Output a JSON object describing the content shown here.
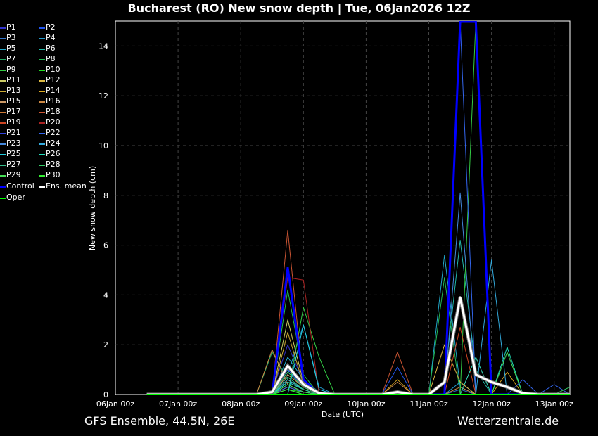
{
  "title": "Bucharest  (RO)  New snow depth | Tue, 06Jan2026 12Z",
  "footer": {
    "left": "GFS Ensemble, 44.5N, 26E",
    "right": "Wetterzentrale.de"
  },
  "colors": {
    "background": "#000000",
    "grid": "#444444",
    "control": "#0000ff",
    "ens_mean": "#ffffff",
    "oper": "#00ff00"
  },
  "chart_data": {
    "type": "line",
    "title": "Bucharest  (RO)  New snow depth | Tue, 06Jan2026 12Z",
    "xlabel": "Date (UTC)",
    "ylabel": "New snow depth (cm)",
    "x_ticks": [
      "06Jan 00z",
      "07Jan 00z",
      "08Jan 00z",
      "09Jan 00z",
      "10Jan 00z",
      "11Jan 00z",
      "12Jan 00z",
      "13Jan 00z"
    ],
    "y_ticks": [
      0,
      2,
      4,
      6,
      8,
      10,
      12,
      14
    ],
    "ylim": [
      0,
      15
    ],
    "xlim_hours": [
      0,
      174
    ],
    "grid": true,
    "legend_placement": "left",
    "x_hours": [
      12,
      18,
      24,
      30,
      36,
      42,
      48,
      54,
      60,
      66,
      72,
      78,
      84,
      90,
      96,
      102,
      108,
      114,
      120,
      126,
      132,
      138,
      144,
      150,
      156,
      162,
      168,
      174
    ],
    "series": [
      {
        "name": "P1",
        "color": "#3333cc",
        "values": [
          0,
          0,
          0,
          0,
          0,
          0,
          0,
          0,
          0.1,
          2.0,
          0.5,
          0.1,
          0,
          0,
          0,
          0,
          0,
          0,
          0,
          0,
          0,
          0,
          0,
          0,
          0,
          0,
          0,
          0
        ]
      },
      {
        "name": "P2",
        "color": "#2255ee",
        "values": [
          0,
          0,
          0,
          0,
          0,
          0,
          0,
          0,
          0,
          1.0,
          0.3,
          0,
          0,
          0,
          0,
          0,
          1.1,
          0,
          0,
          0,
          0,
          0,
          0,
          0,
          0,
          0,
          0,
          0
        ]
      },
      {
        "name": "P3",
        "color": "#3377cc",
        "values": [
          0,
          0,
          0,
          0,
          0,
          0,
          0,
          0,
          0,
          0.5,
          0.2,
          0,
          0,
          0,
          0,
          0,
          0,
          0,
          0,
          0,
          0.2,
          0,
          0,
          0,
          0,
          0,
          0,
          0
        ]
      },
      {
        "name": "P4",
        "color": "#2299cc",
        "values": [
          0,
          0,
          0,
          0,
          0,
          0,
          0,
          0,
          0,
          0.8,
          2.8,
          0.3,
          0,
          0,
          0,
          0,
          0,
          0,
          0,
          0,
          0.5,
          0,
          0,
          0,
          0,
          0,
          0,
          0
        ]
      },
      {
        "name": "P5",
        "color": "#22aacc",
        "values": [
          0,
          0,
          0,
          0,
          0,
          0,
          0,
          0,
          0,
          1.5,
          0.6,
          0.1,
          0,
          0,
          0,
          0,
          0,
          0,
          0,
          5.6,
          0.3,
          0,
          0,
          0,
          0,
          0,
          0,
          0
        ]
      },
      {
        "name": "P6",
        "color": "#22bbaa",
        "values": [
          0,
          0,
          0,
          0,
          0,
          0,
          0,
          0,
          0,
          0.3,
          0.1,
          0,
          0,
          0,
          0,
          0,
          0,
          0,
          0,
          0.5,
          6.2,
          1.0,
          0,
          0,
          0,
          0,
          0,
          0
        ]
      },
      {
        "name": "P7",
        "color": "#22aa66",
        "values": [
          0,
          0,
          0,
          0,
          0,
          0,
          0,
          0,
          1.7,
          0.6,
          0.2,
          0,
          0,
          0,
          0,
          0,
          0,
          0,
          0,
          0,
          0,
          0,
          0,
          0,
          0,
          0,
          0,
          0
        ]
      },
      {
        "name": "P8",
        "color": "#22bb55",
        "values": [
          0,
          0,
          0,
          0,
          0,
          0,
          0,
          0,
          0,
          4.2,
          0.8,
          0,
          0,
          0,
          0,
          0,
          0,
          0,
          0,
          4.7,
          0,
          0,
          0,
          0,
          0,
          0,
          0,
          0
        ]
      },
      {
        "name": "P9",
        "color": "#33cc44",
        "values": [
          0,
          0,
          0,
          0,
          0,
          0,
          0,
          0,
          0,
          0,
          3.5,
          1.5,
          0,
          0,
          0,
          0,
          0,
          0,
          0,
          0,
          0,
          15,
          0,
          0,
          0,
          0,
          0,
          0
        ]
      },
      {
        "name": "P10",
        "color": "#22dd22",
        "values": [
          0,
          0,
          0,
          0,
          0,
          0,
          0,
          0,
          0,
          0.2,
          0.1,
          0,
          0,
          0,
          0,
          0,
          0,
          0,
          0,
          0,
          0,
          0,
          0,
          0,
          0,
          0,
          0,
          0
        ]
      },
      {
        "name": "P11",
        "color": "#cccc66",
        "values": [
          0,
          0,
          0,
          0,
          0,
          0,
          0,
          0,
          0,
          3.0,
          0.5,
          0,
          0,
          0,
          0,
          0,
          0,
          0,
          0,
          0,
          0,
          0,
          0,
          0,
          0,
          0,
          0,
          0
        ]
      },
      {
        "name": "P12",
        "color": "#ddbb44",
        "values": [
          0,
          0,
          0,
          0,
          0,
          0,
          0,
          0,
          0,
          0.6,
          0.2,
          0,
          0,
          0,
          0,
          0,
          0,
          0,
          0,
          2.0,
          0.5,
          0,
          0,
          0,
          0,
          0,
          0,
          0
        ]
      },
      {
        "name": "P13",
        "color": "#ccaa33",
        "values": [
          0,
          0,
          0,
          0,
          0,
          0,
          0,
          0,
          0,
          2.5,
          0.4,
          0,
          0,
          0,
          0,
          0,
          0,
          0,
          0,
          0,
          0,
          0,
          0,
          0,
          0,
          0,
          0,
          0
        ]
      },
      {
        "name": "P14",
        "color": "#ddaa22",
        "values": [
          0,
          0,
          0,
          0,
          0,
          0,
          0,
          0,
          0,
          0.3,
          0.1,
          0,
          0,
          0,
          0,
          0,
          0.6,
          0,
          0,
          0,
          0,
          0,
          0,
          0.9,
          0,
          0,
          0,
          0
        ]
      },
      {
        "name": "P15",
        "color": "#cc9966",
        "values": [
          0,
          0,
          0,
          0,
          0,
          0,
          0,
          0,
          0,
          0.8,
          0.3,
          0,
          0,
          0,
          0,
          0,
          0,
          0,
          0,
          0,
          0,
          0,
          0,
          0,
          0,
          0,
          0,
          0
        ]
      },
      {
        "name": "P16",
        "color": "#cc8844",
        "values": [
          0,
          0,
          0,
          0,
          0,
          0,
          0,
          0,
          1.8,
          0.4,
          0.1,
          0,
          0,
          0,
          0,
          0,
          0.5,
          0,
          0,
          0,
          0.3,
          0,
          0,
          0,
          0,
          0,
          0,
          0
        ]
      },
      {
        "name": "P17",
        "color": "#cc7733",
        "values": [
          0,
          0,
          0,
          0,
          0,
          0,
          0,
          0,
          0,
          0.2,
          0,
          0,
          0,
          0,
          0,
          0,
          0,
          0,
          0,
          0,
          0,
          0,
          0,
          0,
          0,
          0,
          0,
          0
        ]
      },
      {
        "name": "P18",
        "color": "#cc5533",
        "values": [
          0,
          0,
          0,
          0,
          0,
          0,
          0,
          0,
          0,
          6.6,
          0.4,
          0,
          0,
          0,
          0,
          0,
          1.7,
          0,
          0,
          0,
          0,
          0,
          0,
          0,
          0,
          0,
          0,
          0
        ]
      },
      {
        "name": "P19",
        "color": "#cc4422",
        "values": [
          0,
          0,
          0,
          0,
          0,
          0,
          0,
          0,
          0,
          0.3,
          0.1,
          0,
          0,
          0,
          0,
          0,
          0,
          0,
          0,
          0,
          2.7,
          0,
          0,
          0,
          0,
          0,
          0,
          0
        ]
      },
      {
        "name": "P20",
        "color": "#aa2222",
        "values": [
          0,
          0,
          0,
          0,
          0,
          0,
          0,
          0,
          0,
          4.7,
          4.6,
          0,
          0,
          0,
          0,
          0,
          0,
          0,
          0,
          0,
          0,
          1.5,
          0,
          0,
          0,
          0,
          0,
          0
        ]
      },
      {
        "name": "P21",
        "color": "#3344dd",
        "values": [
          0,
          0,
          0,
          0,
          0,
          0,
          0,
          0,
          0,
          0.4,
          0.1,
          0,
          0,
          0,
          0,
          0,
          0,
          0,
          0,
          0,
          0,
          0,
          0,
          0,
          0,
          0,
          0,
          0
        ]
      },
      {
        "name": "P22",
        "color": "#3366ee",
        "values": [
          0,
          0,
          0,
          0,
          0,
          0,
          0,
          0,
          0,
          0.3,
          0.1,
          0,
          0,
          0,
          0,
          0,
          0,
          0,
          0,
          0,
          15,
          0,
          0,
          0,
          0.6,
          0,
          0.4,
          0
        ]
      },
      {
        "name": "P23",
        "color": "#4488dd",
        "values": [
          0,
          0,
          0,
          0,
          0,
          0,
          0,
          0,
          0,
          0.2,
          0,
          0,
          0,
          0,
          0,
          0,
          0,
          0,
          0,
          0,
          8.1,
          0,
          0,
          0,
          0,
          0,
          0,
          0
        ]
      },
      {
        "name": "P24",
        "color": "#33aadd",
        "values": [
          0,
          0,
          0,
          0,
          0,
          0,
          0,
          0,
          0,
          0.6,
          0.2,
          0,
          0,
          0,
          0,
          0,
          0,
          0,
          0,
          0,
          0,
          0,
          5.4,
          0,
          0,
          0,
          0,
          0
        ]
      },
      {
        "name": "P25",
        "color": "#22ccdd",
        "values": [
          0,
          0,
          0,
          0,
          0,
          0,
          0,
          0,
          0,
          0,
          2.8,
          0.2,
          0,
          0,
          0,
          0,
          0,
          0,
          0,
          0,
          0,
          0,
          0,
          0,
          0,
          0,
          0,
          0
        ]
      },
      {
        "name": "P26",
        "color": "#22ddbb",
        "values": [
          0,
          0,
          0,
          0,
          0,
          0,
          0,
          0,
          0,
          0.5,
          0.2,
          0,
          0,
          0,
          0,
          0,
          0,
          0,
          0,
          0,
          0,
          1.5,
          0,
          1.9,
          0,
          0,
          0,
          0
        ]
      },
      {
        "name": "P27",
        "color": "#33bb88",
        "values": [
          0,
          0,
          0,
          0,
          0,
          0,
          0,
          0,
          0,
          0.7,
          0.2,
          0,
          0,
          0,
          0,
          0,
          0,
          0,
          0,
          0,
          0,
          0,
          0,
          0,
          0,
          0,
          0,
          0
        ]
      },
      {
        "name": "P28",
        "color": "#33cc66",
        "values": [
          0,
          0,
          0,
          0,
          0,
          0,
          0,
          0,
          0,
          0.9,
          0.3,
          0,
          0,
          0,
          0,
          0,
          0,
          0,
          0,
          0,
          0,
          0,
          0,
          0,
          0,
          0,
          0,
          0.3
        ]
      },
      {
        "name": "P29",
        "color": "#44dd55",
        "values": [
          0,
          0,
          0,
          0,
          0,
          0,
          0,
          0,
          0,
          0.4,
          0.1,
          0,
          0,
          0,
          0,
          0,
          0,
          0,
          0,
          0,
          0,
          0,
          0,
          1.7,
          0,
          0,
          0,
          0
        ]
      },
      {
        "name": "P30",
        "color": "#33ee33",
        "values": [
          0,
          0,
          0,
          0,
          0,
          0,
          0,
          0,
          0,
          0.2,
          0,
          0,
          0,
          0,
          0,
          0,
          0,
          0,
          0,
          0,
          0,
          0,
          0,
          0,
          0,
          0,
          0,
          0
        ]
      },
      {
        "name": "Control",
        "color": "#0000ff",
        "width": 3,
        "values": [
          0,
          0,
          0,
          0,
          0,
          0,
          0,
          0,
          0,
          5.1,
          0.6,
          0,
          0,
          0,
          0,
          0,
          0,
          0,
          0,
          0,
          15,
          15,
          0,
          0,
          0,
          0,
          0,
          0
        ]
      },
      {
        "name": "Ens. mean",
        "color": "#ffffff",
        "width": 3,
        "values": [
          0,
          0,
          0,
          0,
          0,
          0,
          0,
          0,
          0.1,
          1.15,
          0.4,
          0.05,
          0,
          0,
          0,
          0,
          0.1,
          0,
          0,
          0.5,
          3.9,
          0.8,
          0.5,
          0.3,
          0.05,
          0,
          0,
          0
        ]
      },
      {
        "name": "Oper",
        "color": "#00ff00",
        "width": 2,
        "values": [
          0,
          0,
          0,
          0,
          0,
          0,
          0,
          0,
          0,
          0,
          0,
          0,
          0,
          0,
          0,
          0,
          0,
          0,
          0,
          0,
          0,
          0,
          0,
          0,
          0,
          0,
          0,
          0
        ]
      }
    ]
  }
}
